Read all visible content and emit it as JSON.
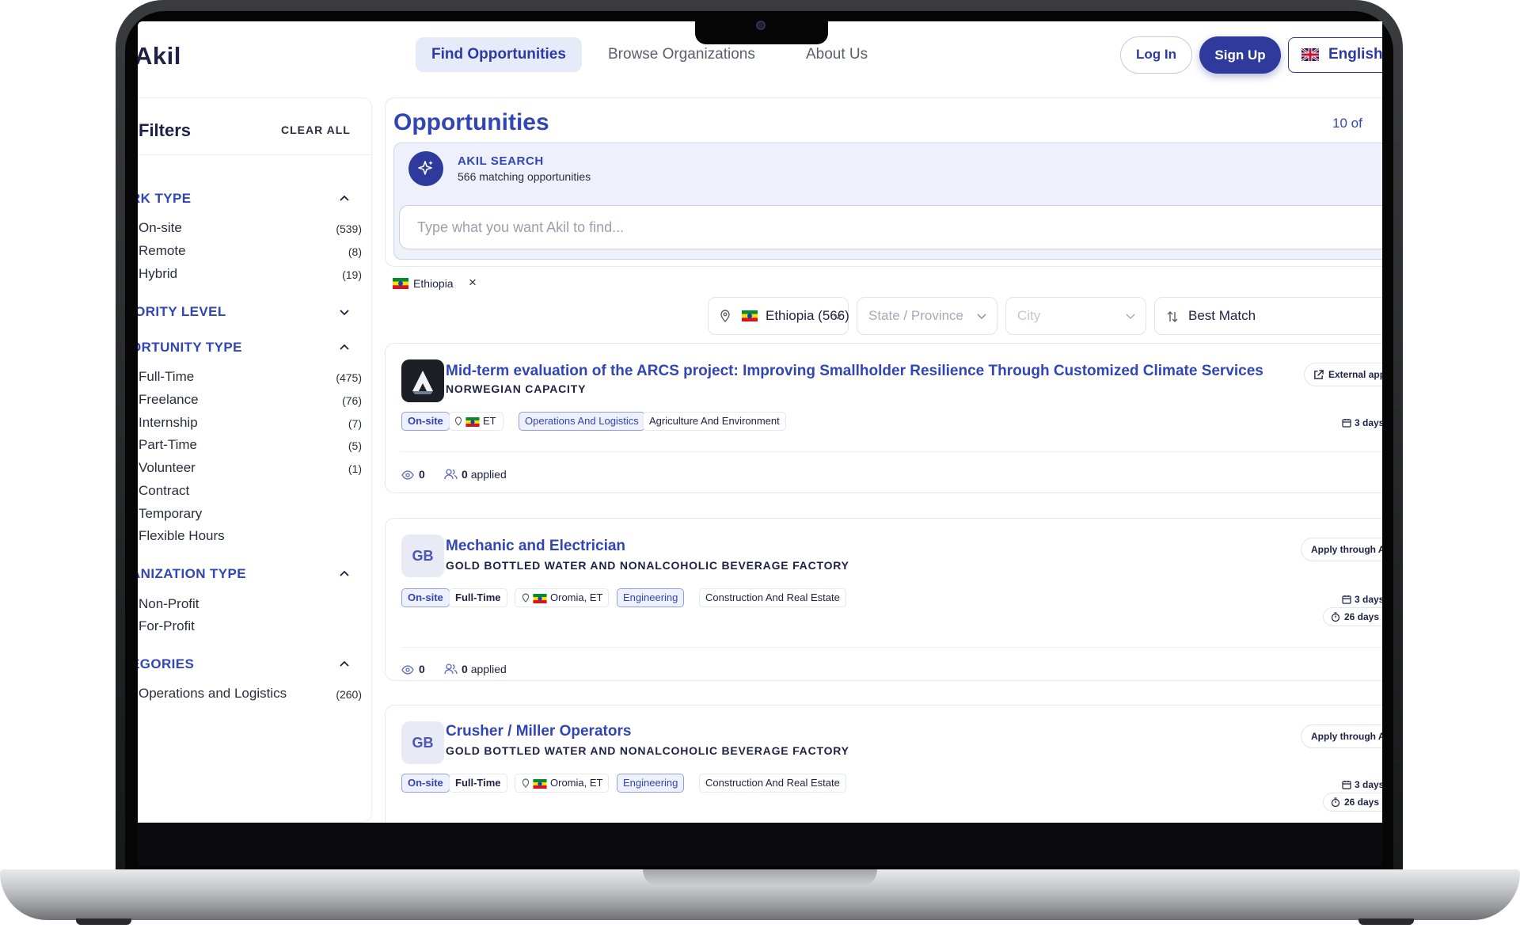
{
  "nav": {
    "logo": "Akil",
    "links": [
      "Find Opportunities",
      "Browse Organizations",
      "About Us"
    ],
    "login": "Log In",
    "signup": "Sign Up",
    "language": "English"
  },
  "sidebar": {
    "title": "Filters",
    "clear_all": "CLEAR ALL",
    "sections": [
      {
        "title": "RK TYPE",
        "expanded": true,
        "options": [
          {
            "label": "On-site",
            "count": "(539)"
          },
          {
            "label": "Remote",
            "count": "(8)"
          },
          {
            "label": "Hybrid",
            "count": "(19)"
          }
        ]
      },
      {
        "title": "IORITY LEVEL",
        "expanded": false,
        "options": []
      },
      {
        "title": "ORTUNITY TYPE",
        "expanded": true,
        "options": [
          {
            "label": "Full-Time",
            "count": "(475)"
          },
          {
            "label": "Freelance",
            "count": "(76)"
          },
          {
            "label": "Internship",
            "count": "(7)"
          },
          {
            "label": "Part-Time",
            "count": "(5)"
          },
          {
            "label": "Volunteer",
            "count": "(1)"
          },
          {
            "label": "Contract",
            "count": ""
          },
          {
            "label": "Temporary",
            "count": ""
          },
          {
            "label": "Flexible Hours",
            "count": ""
          }
        ]
      },
      {
        "title": "ANIZATION TYPE",
        "expanded": true,
        "options": [
          {
            "label": "Non-Profit",
            "count": ""
          },
          {
            "label": "For-Profit",
            "count": ""
          }
        ]
      },
      {
        "title": "EGORIES",
        "expanded": true,
        "options": [
          {
            "label": "Operations and Logistics",
            "count": "(260)"
          }
        ]
      }
    ]
  },
  "main": {
    "title": "Opportunities",
    "page_count": "10 of",
    "akil": {
      "label": "AKIL SEARCH",
      "matching": "566 matching opportunities",
      "placeholder": "Type what you want Akil to find..."
    },
    "active_chip": "Ethiopia",
    "filters": {
      "country": "Ethiopia (566)",
      "state_placeholder": "State / Province",
      "city_placeholder": "City",
      "sort": "Best Match"
    }
  },
  "cards": [
    {
      "logo": "",
      "title": "Mid-term evaluation of the ARCS project: Improving Smallholder Resilience Through Customized Climate Services",
      "org": "NORWEGIAN CAPACITY",
      "tags": [
        "On-site",
        "ET",
        "Operations And Logistics",
        "Agriculture And Environment"
      ],
      "apply": "External app",
      "posted": "3 days",
      "deadline": "",
      "views": "0",
      "applied": "0",
      "applied_label": "applied"
    },
    {
      "logo": "GB",
      "title": "Mechanic and Electrician",
      "org": "GOLD BOTTLED WATER AND NONALCOHOLIC BEVERAGE FACTORY",
      "tags": [
        "On-site",
        "Full-Time",
        "Oromia, ET",
        "Engineering",
        "Construction And Real Estate"
      ],
      "apply": "Apply through A",
      "posted": "3 days",
      "deadline": "26 days l",
      "views": "0",
      "applied": "0",
      "applied_label": "applied"
    },
    {
      "logo": "GB",
      "title": "Crusher / Miller Operators",
      "org": "GOLD BOTTLED WATER AND NONALCOHOLIC BEVERAGE FACTORY",
      "tags": [
        "On-site",
        "Full-Time",
        "Oromia, ET",
        "Engineering",
        "Construction And Real Estate"
      ],
      "apply": "Apply through A",
      "posted": "3 days",
      "deadline": "26 days l",
      "views": "",
      "applied": "",
      "applied_label": ""
    }
  ],
  "colors": {
    "brand": "#2f3b9c",
    "accent_text": "#3145b4",
    "tag_bg": "#eef1fb"
  }
}
